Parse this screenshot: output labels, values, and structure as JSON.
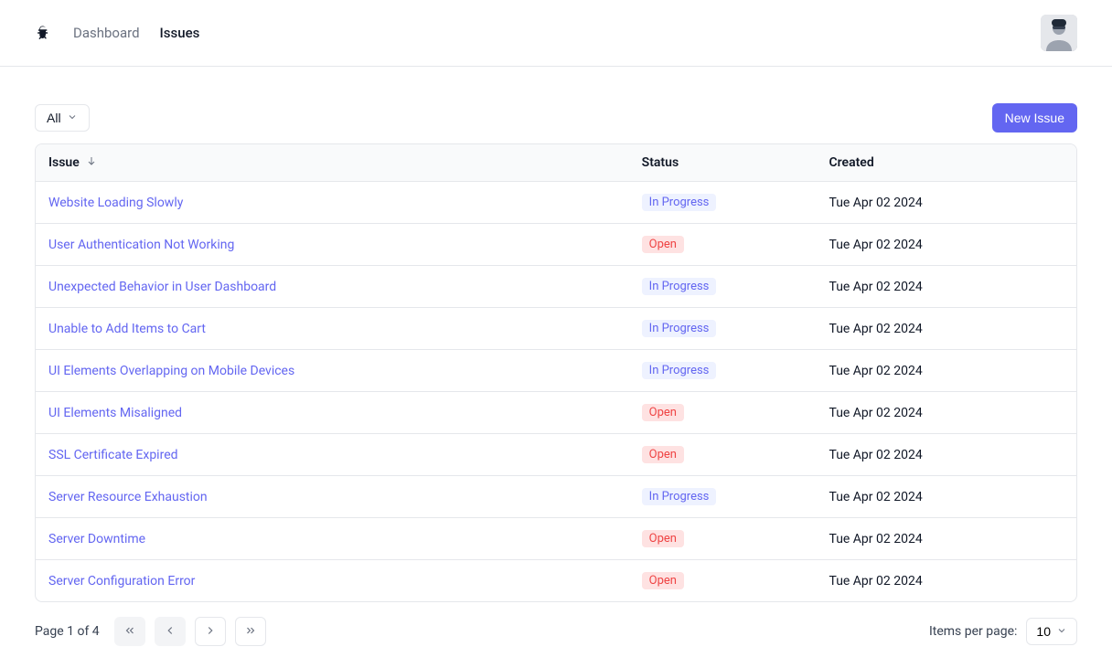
{
  "nav": {
    "dashboard": "Dashboard",
    "issues": "Issues"
  },
  "toolbar": {
    "filter_label": "All",
    "new_issue_label": "New Issue"
  },
  "table": {
    "headers": {
      "issue": "Issue",
      "status": "Status",
      "created": "Created"
    },
    "rows": [
      {
        "title": "Website Loading Slowly",
        "status": "In Progress",
        "status_key": "in-progress",
        "created": "Tue Apr 02 2024"
      },
      {
        "title": "User Authentication Not Working",
        "status": "Open",
        "status_key": "open",
        "created": "Tue Apr 02 2024"
      },
      {
        "title": "Unexpected Behavior in User Dashboard",
        "status": "In Progress",
        "status_key": "in-progress",
        "created": "Tue Apr 02 2024"
      },
      {
        "title": "Unable to Add Items to Cart",
        "status": "In Progress",
        "status_key": "in-progress",
        "created": "Tue Apr 02 2024"
      },
      {
        "title": "UI Elements Overlapping on Mobile Devices",
        "status": "In Progress",
        "status_key": "in-progress",
        "created": "Tue Apr 02 2024"
      },
      {
        "title": "UI Elements Misaligned",
        "status": "Open",
        "status_key": "open",
        "created": "Tue Apr 02 2024"
      },
      {
        "title": "SSL Certificate Expired",
        "status": "Open",
        "status_key": "open",
        "created": "Tue Apr 02 2024"
      },
      {
        "title": "Server Resource Exhaustion",
        "status": "In Progress",
        "status_key": "in-progress",
        "created": "Tue Apr 02 2024"
      },
      {
        "title": "Server Downtime",
        "status": "Open",
        "status_key": "open",
        "created": "Tue Apr 02 2024"
      },
      {
        "title": "Server Configuration Error",
        "status": "Open",
        "status_key": "open",
        "created": "Tue Apr 02 2024"
      }
    ]
  },
  "pagination": {
    "page_info": "Page 1 of 4",
    "per_page_label": "Items per page:",
    "per_page_value": "10"
  }
}
